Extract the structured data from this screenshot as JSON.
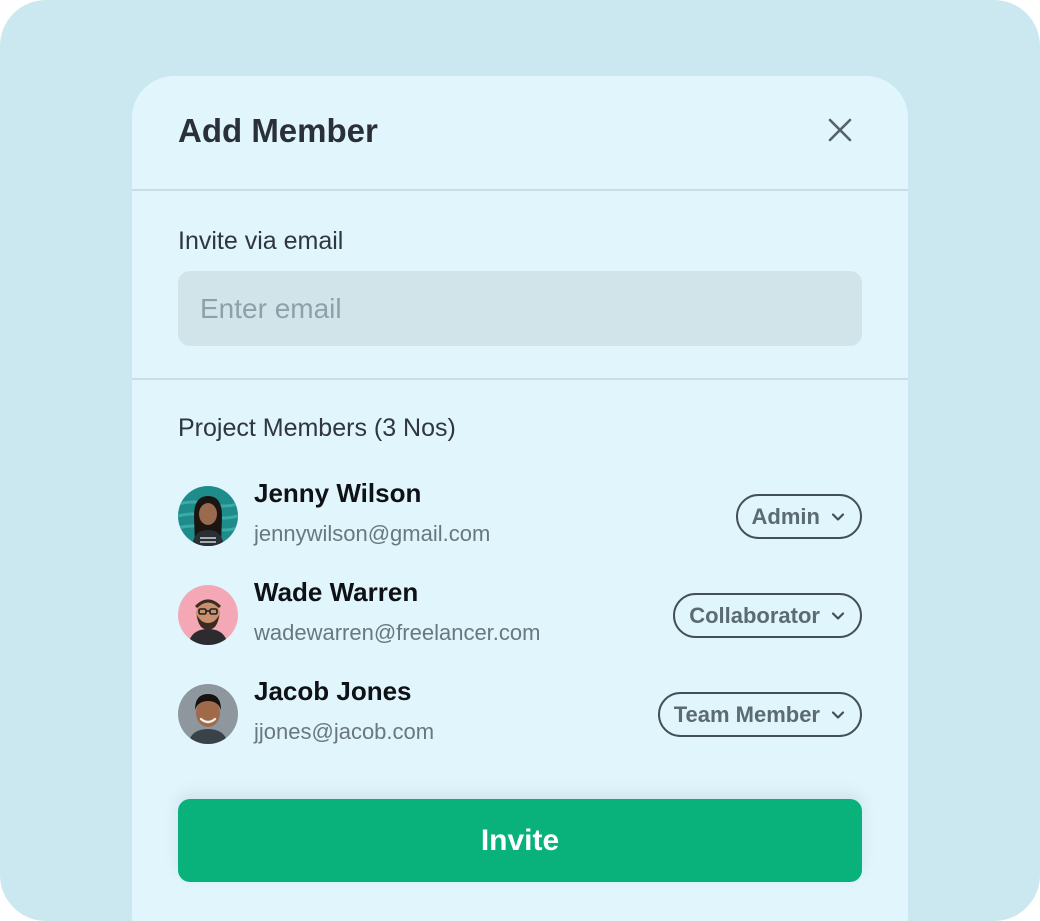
{
  "modal": {
    "title": "Add Member",
    "close_icon": "close-icon"
  },
  "invite_email": {
    "label": "Invite via email",
    "placeholder": "Enter email",
    "value": ""
  },
  "members": {
    "title": "Project Members (3 Nos)",
    "items": [
      {
        "name": "Jenny Wilson",
        "email": "jennywilson@gmail.com",
        "role": "Admin"
      },
      {
        "name": "Wade Warren",
        "email": "wadewarren@freelancer.com",
        "role": "Collaborator"
      },
      {
        "name": "Jacob Jones",
        "email": "jjones@jacob.com",
        "role": "Team Member"
      }
    ]
  },
  "actions": {
    "invite_label": "Invite"
  },
  "colors": {
    "backdrop": "#cbe7f0",
    "modal_bg": "#e1f5fc",
    "input_bg": "#d1e4ea",
    "primary": "#08b27a",
    "border": "#43505a"
  }
}
